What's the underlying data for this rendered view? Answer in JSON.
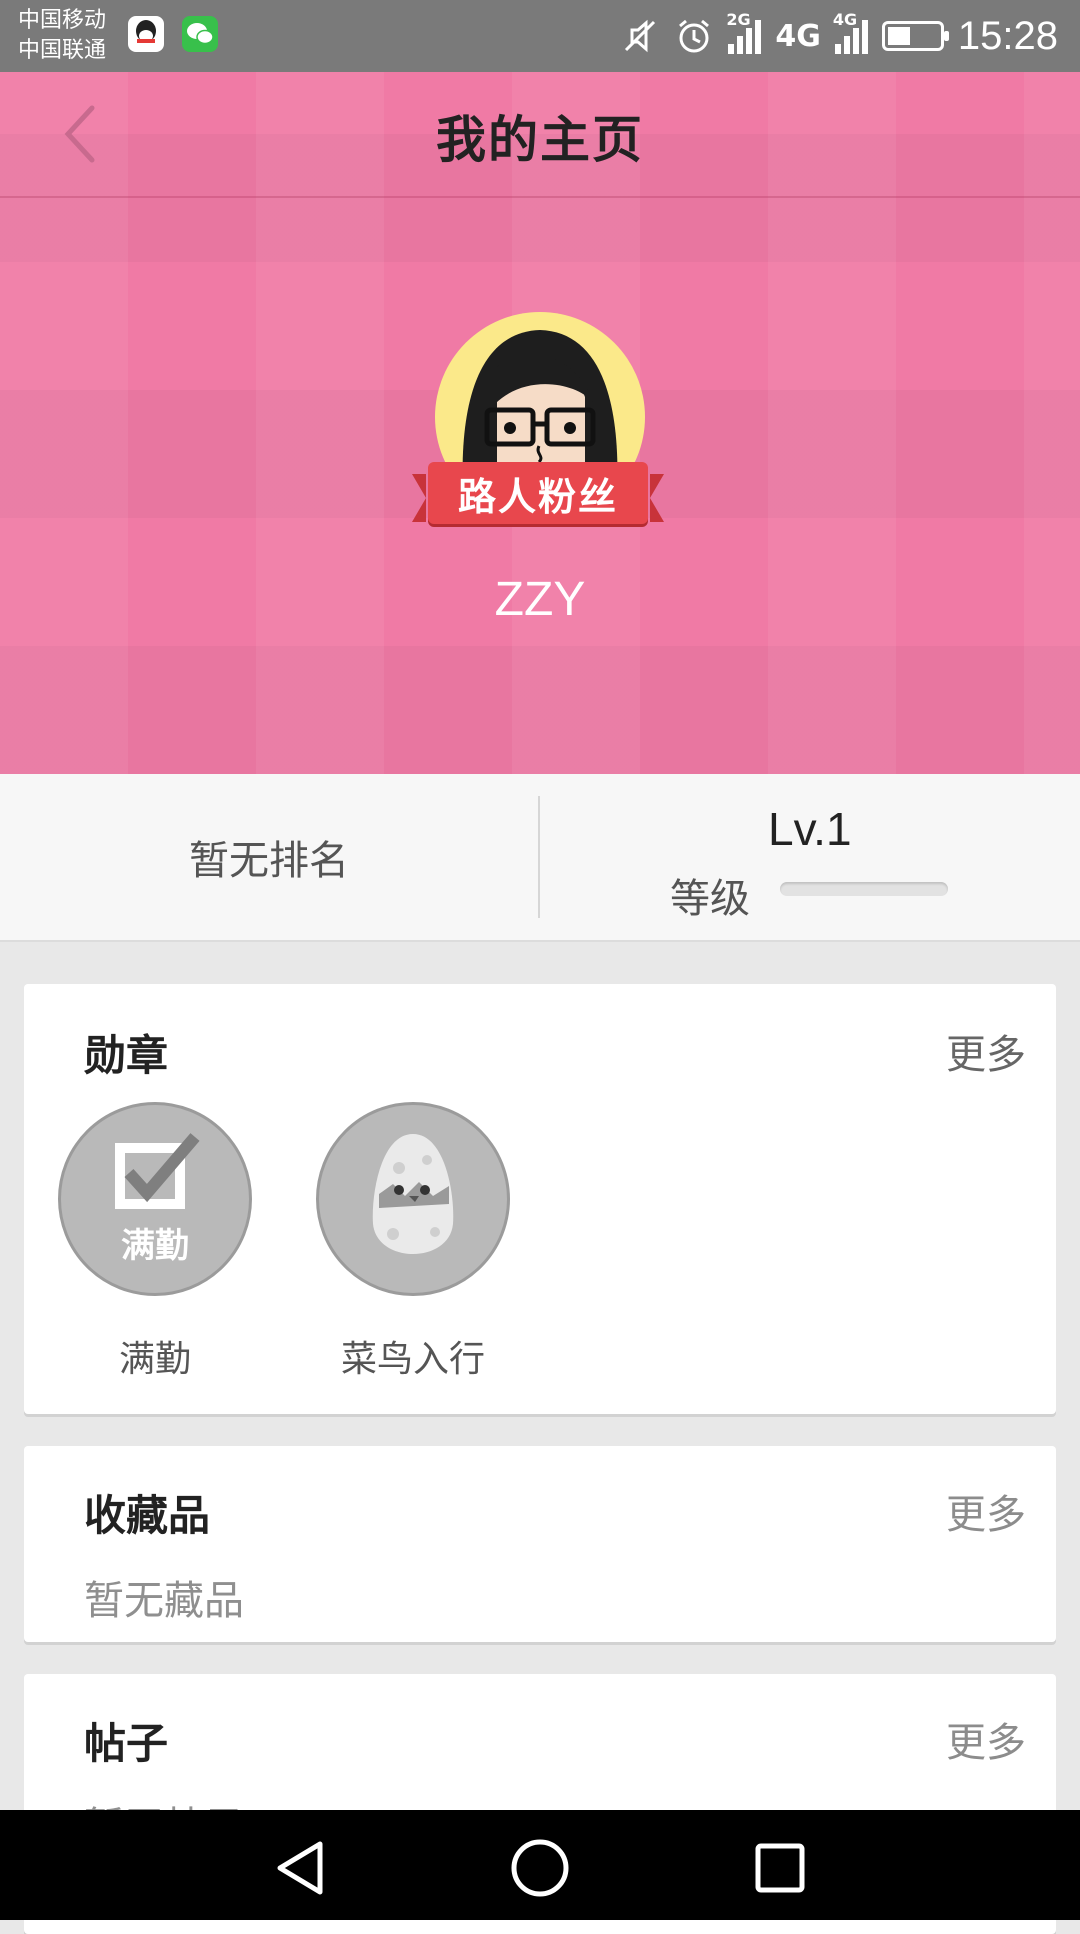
{
  "status_bar": {
    "carrier_1": "中国移动",
    "carrier_2": "中国联通",
    "apps": [
      "qq-icon",
      "wechat-icon"
    ],
    "net_1": "2G",
    "net_2": "4G",
    "net_3": "4G",
    "time": "15:28",
    "battery_level": 0.4
  },
  "header": {
    "title": "我的主页",
    "back_icon": "chevron-left-icon"
  },
  "profile": {
    "badge": "路人粉丝",
    "username": "ZZY"
  },
  "stats": {
    "rank": "暂无排名",
    "level_value": "Lv.1",
    "level_label": "等级",
    "level_progress": 0
  },
  "medals_card": {
    "title": "勋章",
    "more": "更多",
    "items": [
      {
        "label": "满勤",
        "icon_text": "满勤",
        "icon": "checkbox-medal-icon"
      },
      {
        "label": "菜鸟入行",
        "icon": "egg-chick-medal-icon"
      }
    ]
  },
  "collections_card": {
    "title": "收藏品",
    "more": "更多",
    "empty": "暂无藏品"
  },
  "posts_card": {
    "title": "帖子",
    "more": "更多",
    "empty": "暂无帖子"
  },
  "colors": {
    "hero_pink": "#f07aa5",
    "badge_red": "#e8474d",
    "avatar_bg": "#fbe98a"
  }
}
